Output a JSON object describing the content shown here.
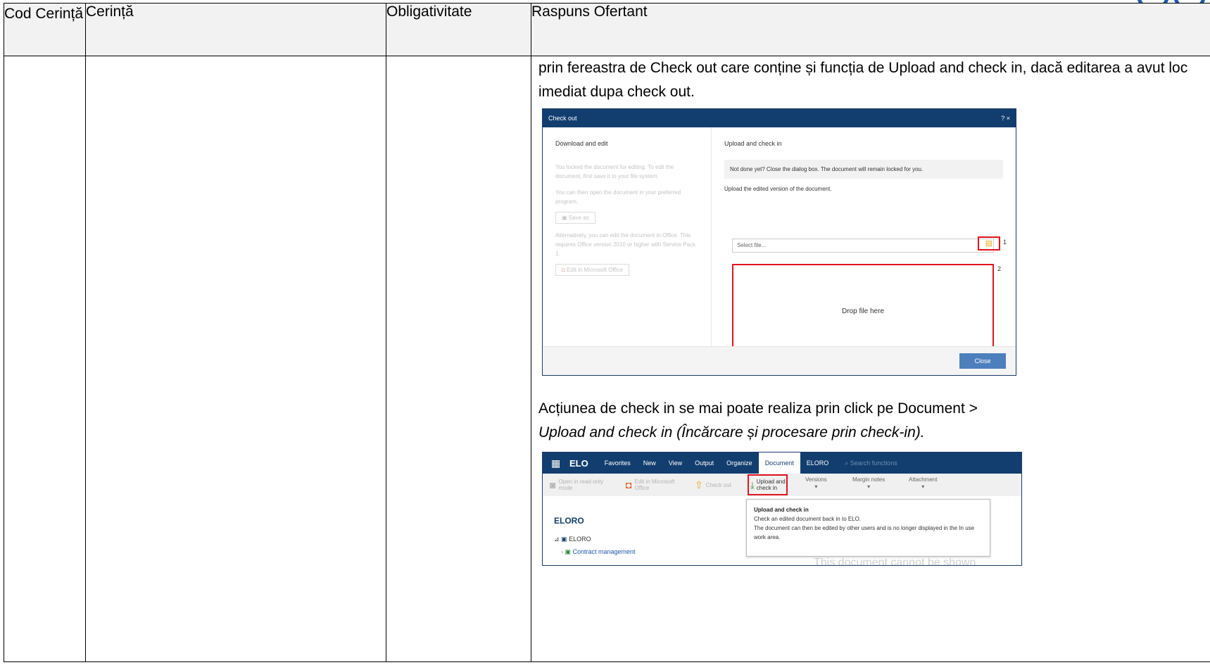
{
  "header": {
    "col1": "Cod Cerință",
    "col2": "Cerință",
    "col3": "Obligativitate",
    "col4": "Raspuns Ofertant"
  },
  "response": {
    "para1": "prin fereastra de Check out care conține și funcția de Upload and check in, dacă editarea a avut loc imediat dupa check out.",
    "para2_line1": "Acțiunea de check in se mai poate realiza prin click pe Document >",
    "para2_line2": "Upload and check in (Încărcare și procesare prin check-in)."
  },
  "dialog": {
    "title": "Check out",
    "controls": "? ×",
    "left_title": "Download and edit",
    "left_text1": "You locked the document for editing. To edit the document, first save it to your file system.",
    "left_text2": "You can then open the document in your preferred program.",
    "save_as": "Save as",
    "left_text3": "Alternatively, you can edit the document in Office. This requires Office version 2010 or higher with Service Pack 1.",
    "edit_office": "Edit in Microsoft Office",
    "right_title": "Upload and check in",
    "note": "Not done yet? Close the dialog box. The document will remain locked for you.",
    "upload_text": "Upload the edited version of the document.",
    "select_placeholder": "Select file...",
    "marker1": "1",
    "drop": "Drop file here",
    "marker2": "2",
    "close": "Close"
  },
  "ribbon": {
    "app": "ELO",
    "tabs": [
      "Favorites",
      "New",
      "View",
      "Output",
      "Organize",
      "Document",
      "ELORO"
    ],
    "search": "Search functions",
    "open_readonly": "Open in read-only mode",
    "edit_office": "Edit in Microsoft Office",
    "check_out": "Check out",
    "upload_checkin": "Upload and check in",
    "versions": "Versions",
    "margin_notes": "Margin notes",
    "attachment": "Attachment",
    "tree_title": "ELORO",
    "tree_root": "ELORO",
    "tree_child": "Contract management",
    "tooltip_title": "Upload and check in",
    "tooltip_line1": "Check an edited document back in to ELO.",
    "tooltip_line2": "The document can then be edited by other users and is no longer displayed in the In use work area.",
    "ghost_text": "This document cannot be shown"
  }
}
